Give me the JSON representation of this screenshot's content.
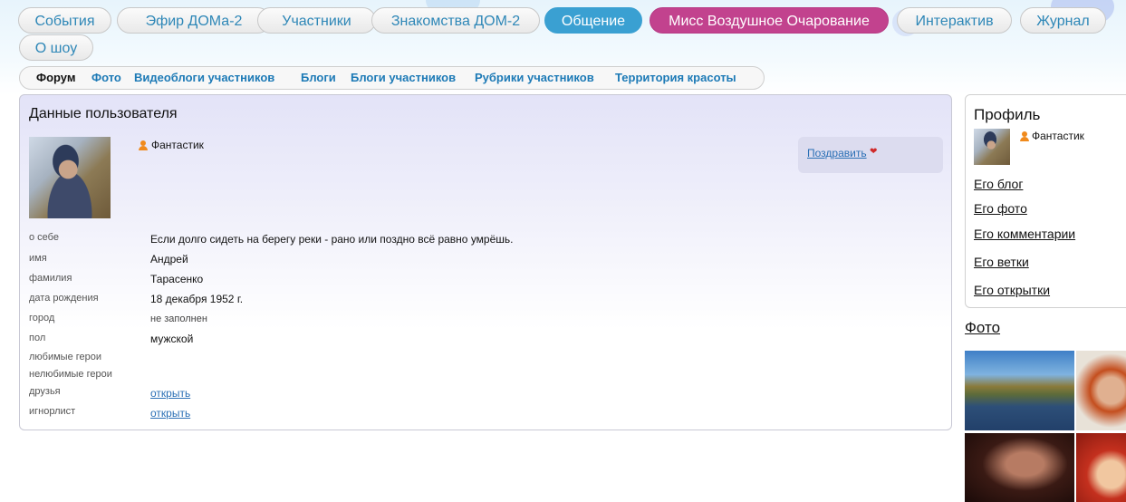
{
  "nav": {
    "items": [
      {
        "label": "События"
      },
      {
        "label": "Эфир ДОМа-2"
      },
      {
        "label": "Участники"
      },
      {
        "label": "Знакомства ДОМ-2"
      },
      {
        "label": "Общение",
        "active": true
      },
      {
        "label": "Мисс Воздушное Очарование",
        "highlight": true
      },
      {
        "label": "Интерактив"
      },
      {
        "label": "Журнал"
      },
      {
        "label": "О шоу"
      }
    ]
  },
  "subnav": {
    "items": [
      {
        "label": "Форум",
        "current": true
      },
      {
        "label": "Фото"
      },
      {
        "label": "Видеоблоги участников"
      },
      {
        "label": "Блоги"
      },
      {
        "label": "Блоги участников"
      },
      {
        "label": "Рубрики участников"
      },
      {
        "label": "Территория красоты"
      }
    ]
  },
  "user_panel": {
    "title": "Данные пользователя",
    "username": "Фантастик",
    "congratulate_label": "Поздравить",
    "fields": [
      {
        "label": "о себе",
        "value": "Если долго сидеть на берегу реки - рано или поздно всё равно умрёшь."
      },
      {
        "label": "имя",
        "value": "Андрей"
      },
      {
        "label": "фамилия",
        "value": "Тарасенко"
      },
      {
        "label": "дата рождения",
        "value": "18 декабря 1952 г."
      },
      {
        "label": "город",
        "value": "не заполнен"
      },
      {
        "label": "пол",
        "value": "мужской"
      },
      {
        "label": "любимые герои",
        "value": ""
      },
      {
        "label": "нелюбимые герои",
        "value": ""
      },
      {
        "label": "друзья",
        "value": "открыть"
      },
      {
        "label": "игнорлист",
        "value": "открыть"
      }
    ]
  },
  "sidebar": {
    "profile_title": "Профиль",
    "username": "Фантастик",
    "links": [
      {
        "label": "Его блог"
      },
      {
        "label": "Его фото"
      },
      {
        "label": "Его комментарии"
      },
      {
        "label": "Его ветки"
      },
      {
        "label": "Его открытки"
      }
    ],
    "photo_heading": "Фото"
  },
  "colors": {
    "nav_text": "#2e87b7",
    "nav_active": "#3aa0d2",
    "nav_highlight": "#c2428e",
    "link": "#2a6fb5",
    "user_icon": "#f08a1c"
  }
}
